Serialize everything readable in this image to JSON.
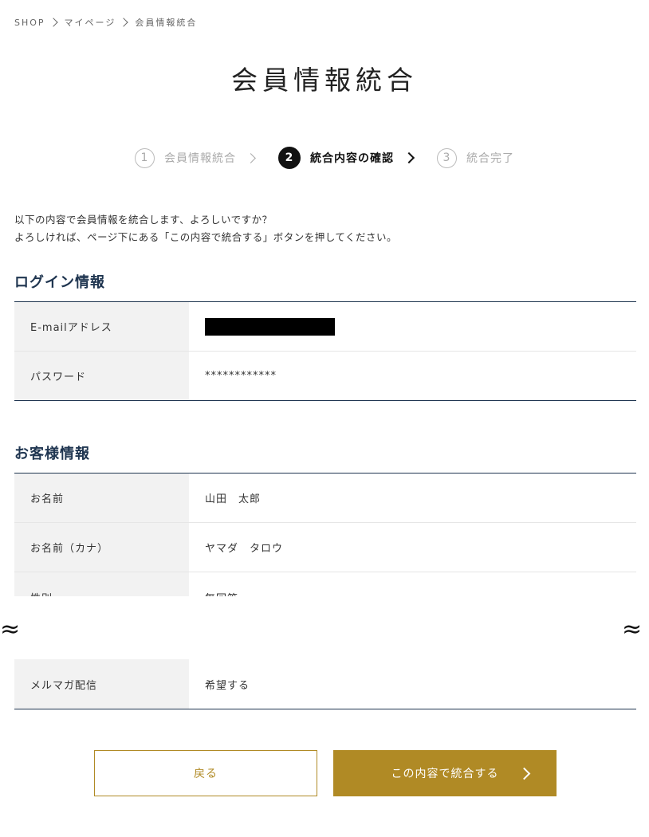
{
  "breadcrumb": {
    "items": [
      "SHOP",
      "マイページ",
      "会員情報統合"
    ]
  },
  "page_title": "会員情報統合",
  "steps": [
    {
      "number": "1",
      "label": "会員情報統合"
    },
    {
      "number": "2",
      "label": "統合内容の確認"
    },
    {
      "number": "3",
      "label": "統合完了"
    }
  ],
  "intro": {
    "line1": "以下の内容で会員情報を統合します、よろしいですか？",
    "line2": "よろしければ、ページ下にある「この内容で統合する」ボタンを押してください。"
  },
  "login_section": {
    "heading": "ログイン情報",
    "rows": [
      {
        "label": "E-mailアドレス",
        "value": ""
      },
      {
        "label": "パスワード",
        "value": "************"
      }
    ]
  },
  "customer_section": {
    "heading": "お客様情報",
    "rows": [
      {
        "label": "お名前",
        "value": "山田　太郎"
      },
      {
        "label": "お名前（カナ）",
        "value": "ヤマダ　タロウ"
      },
      {
        "label": "性別",
        "value": "無回答"
      }
    ],
    "last_row": {
      "label": "メルマガ配信",
      "value": "希望する"
    }
  },
  "omission_mark": "≈",
  "buttons": {
    "back_label": "戻る",
    "submit_label": "この内容で統合する"
  },
  "colors": {
    "accent": "#b08a25",
    "heading": "#1f3550"
  }
}
